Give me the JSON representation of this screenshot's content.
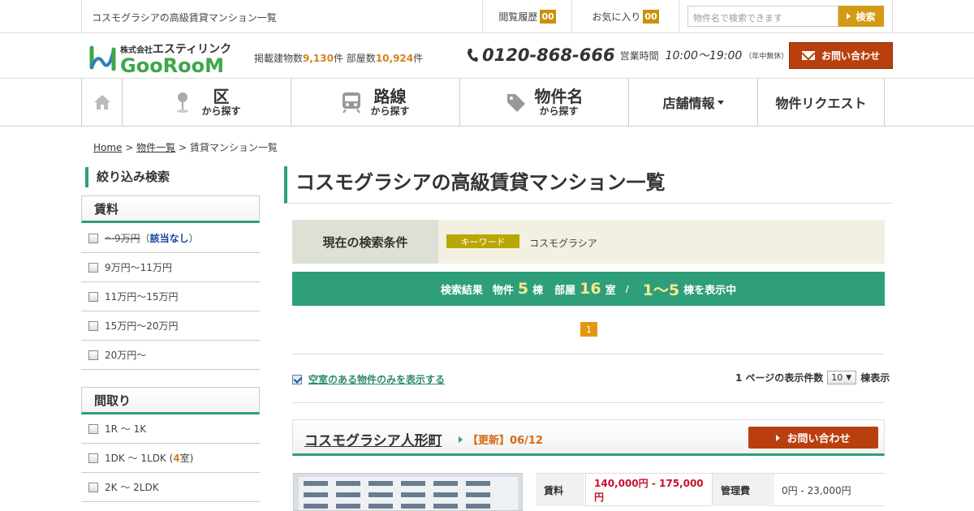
{
  "topbar": {
    "title": "コスモグラシアの高級賃貸マンション一覧",
    "history_label": "閲覧履歴",
    "history_count": "00",
    "favorites_label": "お気に入り",
    "favorites_count": "00",
    "search_placeholder": "物件名で検索できます",
    "search_button": "検索"
  },
  "header": {
    "logo_company_small": "株式会社",
    "logo_company": "エスティリンク",
    "logo_name": "GooRooM",
    "stats_prefix": "掲載建物数",
    "buildings": "9,130",
    "stats_mid1": "件 部屋数",
    "rooms": "10,924",
    "stats_suffix": "件",
    "phone": "0120-868-666",
    "hours_label": "営業時間",
    "hours": "10:00～19:00",
    "hours_note": "（年中無休）",
    "contact_button": "お問い合わせ"
  },
  "nav": {
    "items": [
      {
        "main": "区",
        "sub": "から探す"
      },
      {
        "main": "路線",
        "sub": "から探す"
      },
      {
        "main": "物件名",
        "sub": "から探す"
      },
      {
        "main": "店舗情報"
      },
      {
        "main": "物件リクエスト"
      }
    ]
  },
  "breadcrumb": {
    "home": "Home",
    "sep": " > ",
    "list": "物件一覧",
    "current": "賃貸マンション一覧"
  },
  "sidebar": {
    "title": "絞り込み検索",
    "rent_head": "賃料",
    "rent_options": [
      {
        "label": "～9万円",
        "note_open": "（",
        "note": "該当なし",
        "note_close": "）"
      },
      {
        "label": "9万円～11万円"
      },
      {
        "label": "11万円～15万円"
      },
      {
        "label": "15万円～20万円"
      },
      {
        "label": "20万円～"
      }
    ],
    "layout_head": "間取り",
    "layout_options": [
      {
        "label": "1R ～ 1K"
      },
      {
        "label": "1DK ～ 1LDK (",
        "count": "4",
        "suffix": "室)"
      },
      {
        "label": "2K ～ 2LDK"
      }
    ]
  },
  "main": {
    "title": "コスモグラシアの高級賃貸マンション一覧",
    "cond_label": "現在の検索条件",
    "cond_tag": "キーワード",
    "cond_value": "コスモグラシア",
    "result_label": "検索結果",
    "result_buildings_label": "物件",
    "result_buildings": "5",
    "result_buildings_unit": "棟",
    "result_rooms_label": "部屋",
    "result_rooms": "16",
    "result_rooms_unit": "室",
    "result_sep": "/",
    "result_range": "1～5",
    "result_range_suffix": "棟を表示中",
    "page": "1",
    "vacant_label": "空室のある物件のみを表示する",
    "perpage_label": "1 ページの表示件数",
    "perpage_value": "10",
    "perpage_suffix": "棟表示"
  },
  "property": {
    "name": "コスモグラシア人形町",
    "updated": "【更新】06/12",
    "contact_button": "お問い合わせ",
    "rent_label": "賃料",
    "rent_value": "140,000円 - 175,000円",
    "fee_label": "管理費",
    "fee_value": "0円 - 23,000円"
  },
  "colors": {
    "accent_green": "#2f9e7a",
    "contact_red": "#b9400e",
    "badge_orange": "#c8920a"
  }
}
